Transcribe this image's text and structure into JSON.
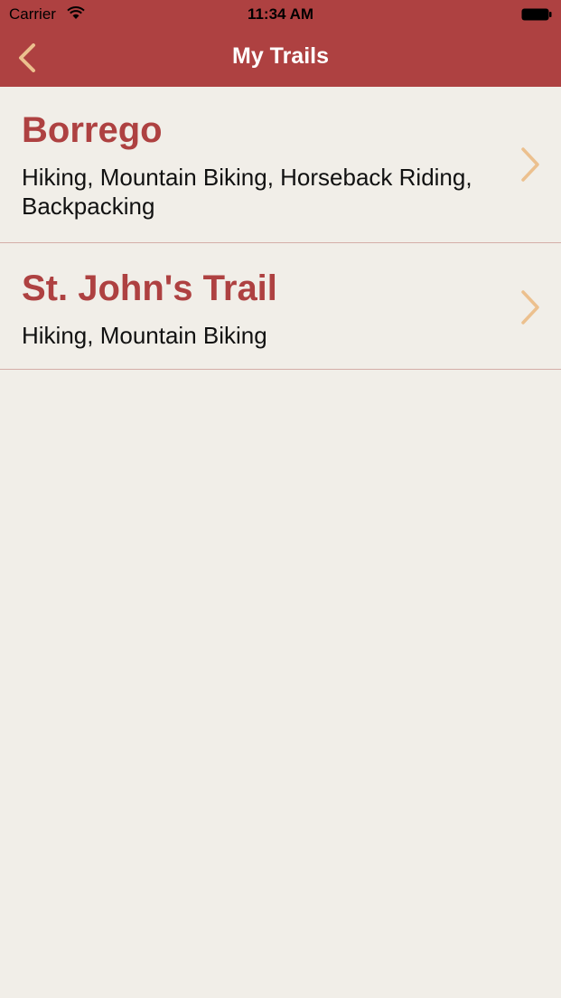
{
  "status_bar": {
    "carrier": "Carrier",
    "time": "11:34 AM",
    "wifi_icon": "wifi-icon",
    "battery_icon": "battery-icon"
  },
  "nav": {
    "title": "My Trails",
    "back_icon": "chevron-left-icon"
  },
  "colors": {
    "brand": "#ae4141",
    "accent": "#ecc08e",
    "background": "#f1eee8",
    "separator": "#d4aea8"
  },
  "trails": [
    {
      "name": "Borrego",
      "activities": "Hiking, Mountain Biking, Horseback Riding, Backpacking",
      "chevron_icon": "chevron-right-icon"
    },
    {
      "name": "St. John's Trail",
      "activities": "Hiking, Mountain Biking",
      "chevron_icon": "chevron-right-icon"
    }
  ]
}
